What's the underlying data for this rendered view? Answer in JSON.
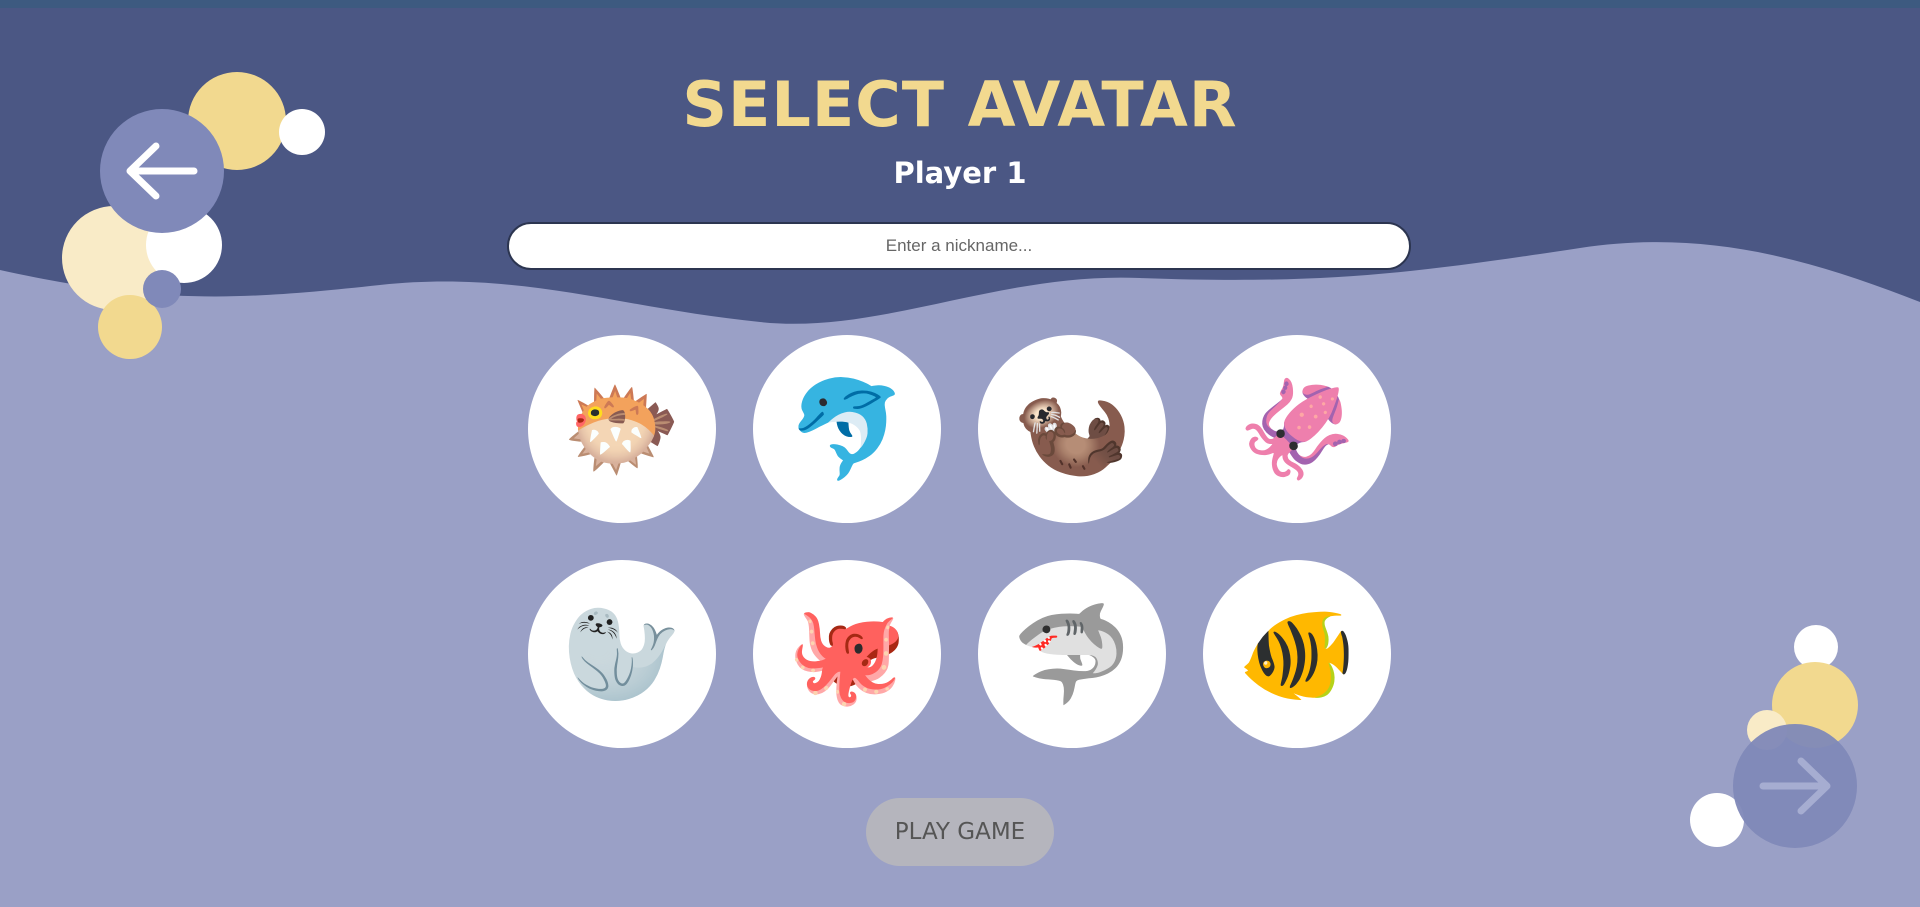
{
  "page": {
    "title": "SELECT AVATAR",
    "subtitle": "Player 1"
  },
  "nickname": {
    "placeholder": "Enter a nickname...",
    "value": ""
  },
  "avatars": [
    {
      "name": "blowfish",
      "emoji": "🐡"
    },
    {
      "name": "dolphin",
      "emoji": "🐬"
    },
    {
      "name": "otter",
      "emoji": "🦦"
    },
    {
      "name": "squid",
      "emoji": "🦑"
    },
    {
      "name": "seal",
      "emoji": "🦭"
    },
    {
      "name": "octopus",
      "emoji": "🐙"
    },
    {
      "name": "shark",
      "emoji": "🦈"
    },
    {
      "name": "tropical-fish",
      "emoji": "🐠"
    }
  ],
  "actions": {
    "play_label": "PLAY GAME",
    "back_icon": "arrow-left-icon",
    "next_icon": "arrow-right-icon"
  },
  "colors": {
    "header_bg": "#4b5784",
    "body_bg": "#9aa0c6",
    "title": "#f2d98f",
    "bubble_yellow": "#f2d98f",
    "bubble_cream": "#f9ebc7",
    "nav_button": "#8089b9",
    "play_button": "#b5b5bd"
  }
}
